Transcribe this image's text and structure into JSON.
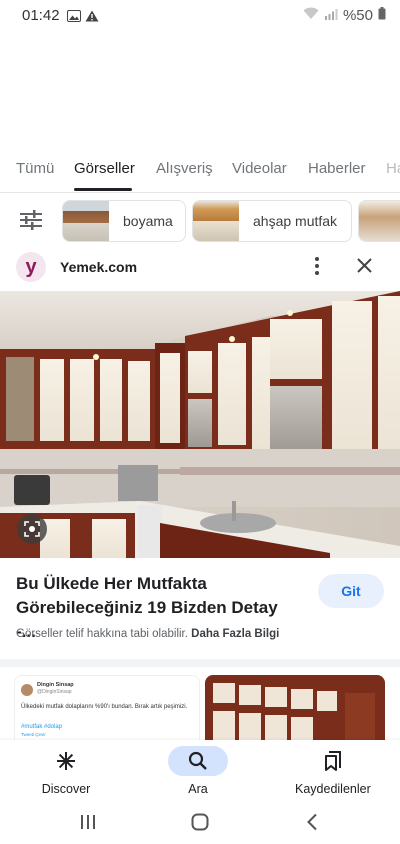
{
  "status": {
    "time": "01:42",
    "battery": "%50"
  },
  "tabs": [
    {
      "label": "Tümü",
      "active": false
    },
    {
      "label": "Görseller",
      "active": true
    },
    {
      "label": "Alışveriş",
      "active": false
    },
    {
      "label": "Videolar",
      "active": false
    },
    {
      "label": "Haberler",
      "active": false
    },
    {
      "label": "Ha",
      "active": false
    }
  ],
  "chips": [
    {
      "label": "boyama"
    },
    {
      "label": "ahşap mutfak"
    }
  ],
  "source": {
    "name": "Yemek.com",
    "logo_letter": "y"
  },
  "result": {
    "title": "Bu Ülkede Her Mutfakta Görebileceğiniz 19 Bizden Detay -...",
    "visit_label": "Git",
    "copyright_text": "Görseller telif hakkına tabi olabilir.",
    "more_info": "Daha Fazla Bilgi"
  },
  "related": {
    "tweet_user": "Dingin Sinsap",
    "tweet_handle": "@DinginSinsap",
    "tweet_text": "Ülkedeki mutfak dolaplarını %90'ı bundan. Bırak artık peşimizi.",
    "tweet_tag": "#mutfak #dolap",
    "tweet_meta": "Tweeti Çevir"
  },
  "bottom_nav": [
    {
      "label": "Discover",
      "icon": "asterisk-icon"
    },
    {
      "label": "Ara",
      "icon": "search-icon",
      "active": true
    },
    {
      "label": "Kaydedilenler",
      "icon": "bookmarks-icon"
    }
  ],
  "colors": {
    "accent": "#1a73e8",
    "brand": "#8e1b5a"
  }
}
